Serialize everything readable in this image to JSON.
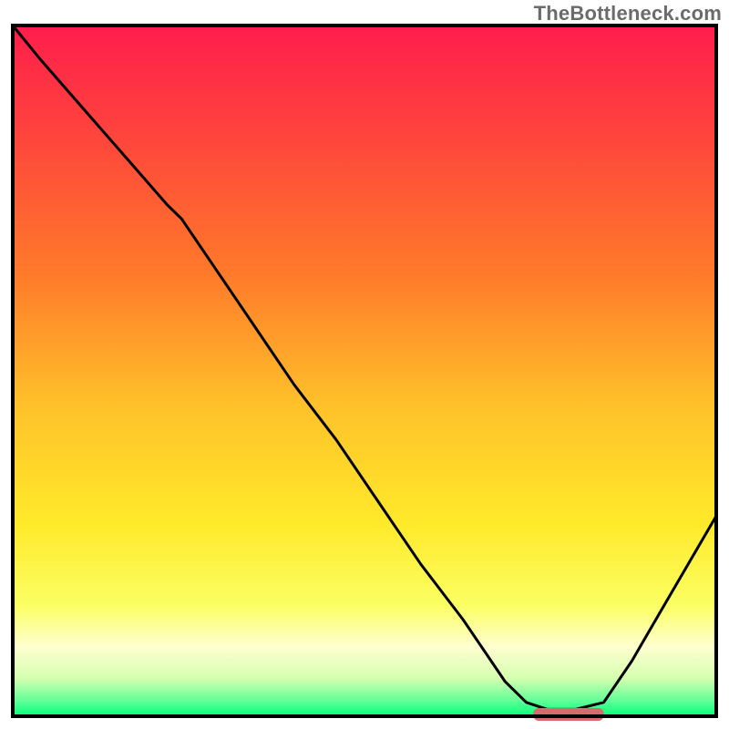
{
  "watermark": "TheBottleneck.com",
  "colors": {
    "curve": "#000000",
    "frame": "#000000",
    "marker": "#d66b6b",
    "gradient_stops": [
      {
        "offset": 0.0,
        "color": "#ff1d4c"
      },
      {
        "offset": 0.18,
        "color": "#ff4a3a"
      },
      {
        "offset": 0.36,
        "color": "#ff7a2a"
      },
      {
        "offset": 0.55,
        "color": "#ffc12a"
      },
      {
        "offset": 0.72,
        "color": "#ffe92a"
      },
      {
        "offset": 0.84,
        "color": "#fbff63"
      },
      {
        "offset": 0.9,
        "color": "#feffd0"
      },
      {
        "offset": 0.945,
        "color": "#d6ffb0"
      },
      {
        "offset": 0.975,
        "color": "#6bff9a"
      },
      {
        "offset": 1.0,
        "color": "#00ff7a"
      }
    ]
  },
  "chart_data": {
    "type": "line",
    "title": "",
    "xlabel": "",
    "ylabel": "",
    "xlim": [
      0,
      100
    ],
    "ylim": [
      0,
      100
    ],
    "x": [
      0,
      4,
      10,
      16,
      22,
      24,
      28,
      34,
      40,
      46,
      52,
      58,
      64,
      70,
      73,
      76,
      80,
      84,
      88,
      92,
      96,
      100
    ],
    "values": [
      100,
      95,
      88,
      81,
      74,
      72,
      66,
      57,
      48,
      40,
      31,
      22,
      14,
      5,
      2,
      1,
      1,
      2,
      8,
      15,
      22,
      29
    ],
    "optimum_range_x": [
      74,
      84
    ],
    "legend": [],
    "grid": false
  }
}
